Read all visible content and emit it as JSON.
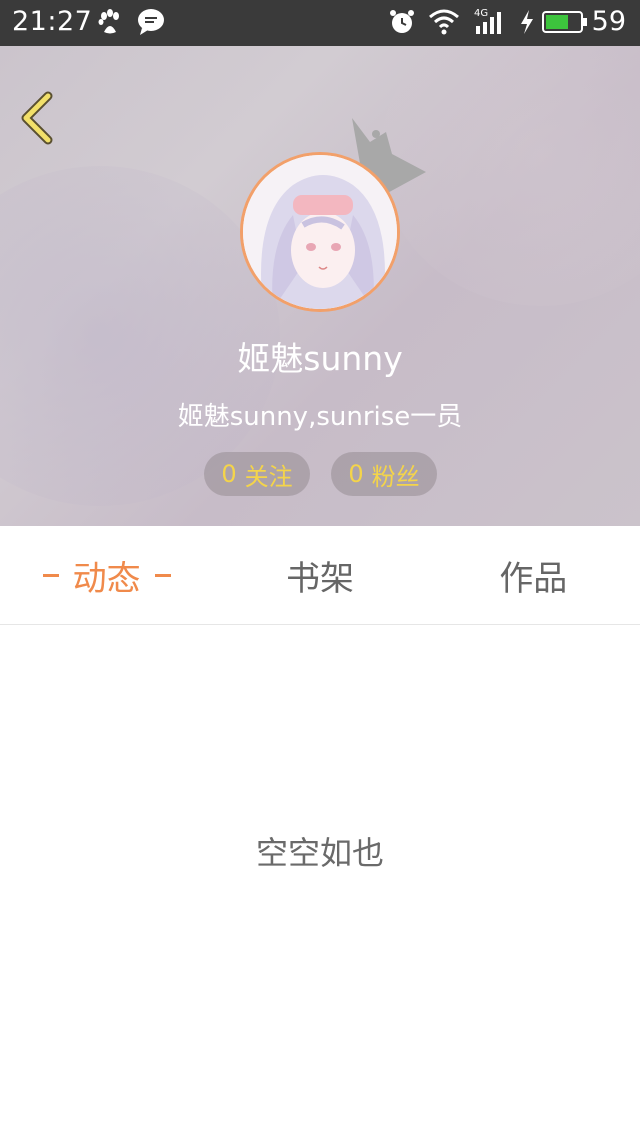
{
  "status_bar": {
    "time": "21:27",
    "network": "4G",
    "battery_percent": "59",
    "icons": [
      "baidu-paw-icon",
      "message-bubble-icon",
      "alarm-icon",
      "wifi-icon",
      "signal-icon",
      "charging-bolt-icon",
      "battery-icon"
    ]
  },
  "header": {
    "back_icon": "chevron-left-icon",
    "username": "姬魅sunny",
    "bio": "姬魅sunny,sunrise一员",
    "following_count": "0",
    "following_label": "关注",
    "fans_count": "0",
    "fans_label": "粉丝"
  },
  "tabs": [
    {
      "label": "动态",
      "active": true
    },
    {
      "label": "书架",
      "active": false
    },
    {
      "label": "作品",
      "active": false
    }
  ],
  "content": {
    "empty_text": "空空如也"
  },
  "colors": {
    "accent": "#f08a4b",
    "count_text": "#f4d44a",
    "back_arrow": "#f2e06a"
  }
}
